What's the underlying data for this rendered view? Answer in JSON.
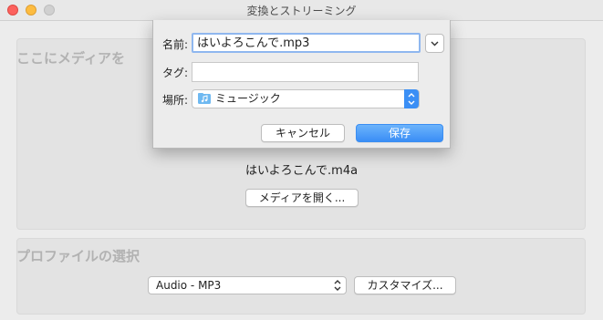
{
  "window": {
    "title": "変換とストリーミング"
  },
  "media_section": {
    "heading": "ここにメディアを",
    "filename": "はいよろこんで.m4a",
    "open_media_button": "メディアを開く..."
  },
  "profile_section": {
    "heading": "プロファイルの選択",
    "selected_profile": "Audio - MP3",
    "customize_button": "カスタマイズ..."
  },
  "save_sheet": {
    "name_label": "名前:",
    "name_value": "はいよろこんで.mp3",
    "tags_label": "タグ:",
    "tags_value": "",
    "where_label": "場所:",
    "where_value": "ミュージック",
    "cancel_button": "キャンセル",
    "save_button": "保存"
  },
  "icons": {
    "expand": "chevron-down-icon",
    "folder": "music-folder-icon",
    "popup_arrows": "up-down-arrows-icon"
  },
  "colors": {
    "accent": "#3b8ff5",
    "focus_ring": "#8fb7ef"
  }
}
